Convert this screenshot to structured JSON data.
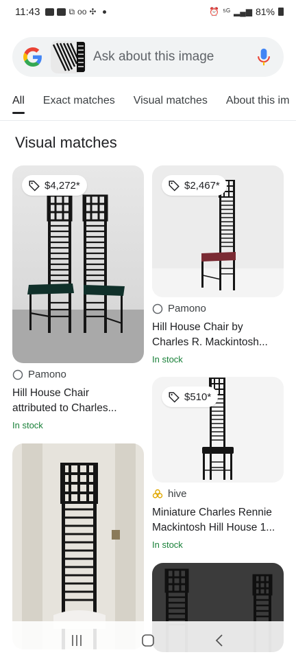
{
  "status_bar": {
    "time": "11:43",
    "battery": "81%"
  },
  "search": {
    "placeholder": "Ask about this image"
  },
  "tabs": [
    {
      "label": "All",
      "active": true
    },
    {
      "label": "Exact matches",
      "active": false
    },
    {
      "label": "Visual matches",
      "active": false
    },
    {
      "label": "About this im",
      "active": false
    }
  ],
  "section_title": "Visual matches",
  "results": [
    {
      "price": "$4,272*",
      "source": "Pamono",
      "title_line1": "Hill House Chair",
      "title_line2": "attributed to Charles...",
      "stock": "In stock"
    },
    {
      "price": "$2,467*",
      "source": "Pamono",
      "title_line1": "Hill House Chair by",
      "title_line2": "Charles R. Mackintosh...",
      "stock": "In stock"
    },
    {
      "price": "$510*",
      "source": "hive",
      "title_line1": "Miniature Charles Rennie",
      "title_line2": "Mackintosh Hill House 1...",
      "stock": "In stock"
    }
  ],
  "colors": {
    "stock_green": "#188038",
    "search_bg": "#f1f3f4",
    "chair_black": "#111111"
  },
  "icons": {
    "google": "google-logo",
    "mic": "mic-icon",
    "price_tag": "tag-icon",
    "source": "globe-icon",
    "hive": "hive-flower-icon",
    "nav_recent": "recent-apps-icon",
    "nav_home": "home-icon",
    "nav_back": "back-icon"
  }
}
